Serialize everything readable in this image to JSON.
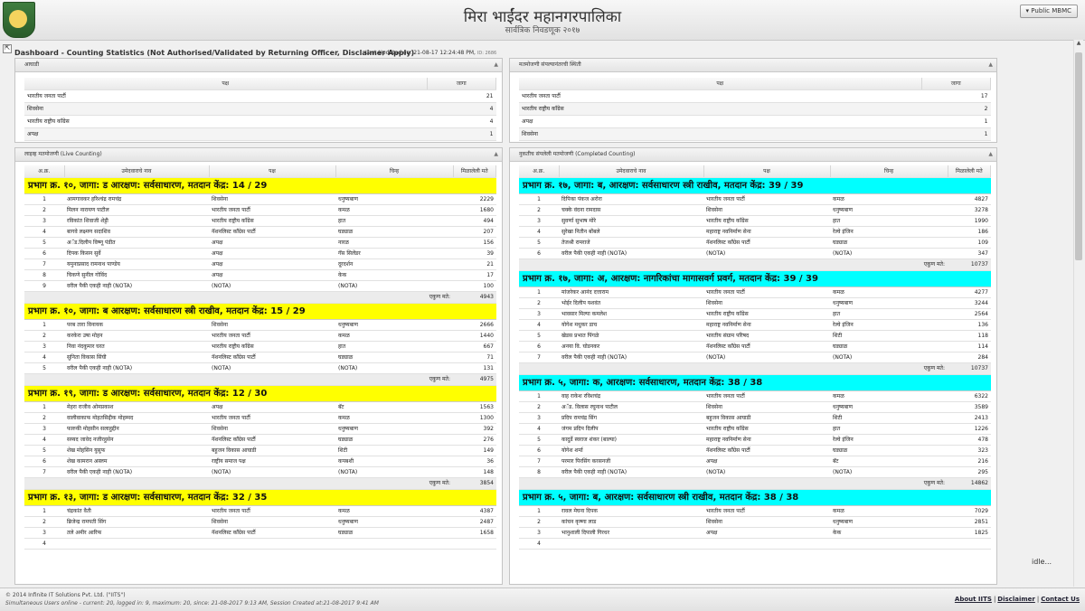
{
  "header": {
    "title": "मिरा भाईंदर महानगरपालिका",
    "subtitle": "सार्वत्रिक निवडणूक २०१७",
    "public_button": "Public MBMC",
    "dropdown_icon": "dropdown-icon"
  },
  "dashboard": {
    "expand_symbol": "⇱",
    "title": "Dashboard - Counting Statistics (Not Authorised/Validated by Returning Officer, Disclaimer Apply)",
    "last_updated": "Last Updated on: 21-08-17 12:24:48 PM,",
    "id": "ID: 2686"
  },
  "leads": {
    "title": "आघाडी",
    "col_party": "पक्ष",
    "col_seats": "जागा",
    "rows": [
      {
        "party": "भारतीय जनता पार्टी",
        "seats": "21"
      },
      {
        "party": "शिवसेना",
        "seats": "4"
      },
      {
        "party": "भारतीय राष्ट्रीय काँग्रेस",
        "seats": "4"
      },
      {
        "party": "अपक्ष",
        "seats": "1"
      }
    ]
  },
  "results": {
    "title": "मतमोजणी संपल्यानंतरची स्थिती",
    "col_party": "पक्ष",
    "col_seats": "जागा",
    "rows": [
      {
        "party": "भारतीय जनता पार्टी",
        "seats": "17"
      },
      {
        "party": "भारतीय राष्ट्रीय काँग्रेस",
        "seats": "2"
      },
      {
        "party": "अपक्ष",
        "seats": "1"
      },
      {
        "party": "शिवसेना",
        "seats": "1"
      }
    ]
  },
  "live": {
    "title": "लाइव्ह मतमोजणी (Live Counting)",
    "headers": {
      "sr": "अ.क्र.",
      "candidate": "उमेदवाराचे नाव",
      "party": "पक्ष",
      "symbol": "चिन्ह",
      "votes": "मिळालेली मते"
    },
    "total_label": "एकुण मते:",
    "wards": [
      {
        "title": "प्रभाग क्र. १०, जागा: ड आरक्षण: सर्वसाधारण, मतदान केंद्र: 14 / 29",
        "total": "4943",
        "rows": [
          {
            "sr": "1",
            "name": "आमगावकर हरिश्चंद्र रामचंद्र",
            "party": "शिवसेना",
            "symbol": "धनुष्यबाण",
            "votes": "2229"
          },
          {
            "sr": "2",
            "name": "मिलन नारायण पाटील",
            "party": "भारतीय जनता पार्टी",
            "symbol": "कमळ",
            "votes": "1680"
          },
          {
            "sr": "3",
            "name": "रविकांत शिवाजी शेट्टी",
            "party": "भारतीय राष्ट्रीय काँग्रेस",
            "symbol": "हात",
            "votes": "494"
          },
          {
            "sr": "4",
            "name": "बागवे लक्ष्मण सदाशिव",
            "party": "नॅशनलिस्ट काँग्रेस पार्टी",
            "symbol": "घड्याळ",
            "votes": "207"
          },
          {
            "sr": "5",
            "name": "अॅड.दिलीप विष्णू पंडीत",
            "party": "अपक्ष",
            "symbol": "नारळ",
            "votes": "156"
          },
          {
            "sr": "6",
            "name": "दिपक किसन सुर्वे",
            "party": "अपक्ष",
            "symbol": "गॅस सिलेंडर",
            "votes": "39"
          },
          {
            "sr": "7",
            "name": "यमुनाप्रसाद रामनाथ पाण्डेय",
            "party": "अपक्ष",
            "symbol": "दूरदर्शन",
            "votes": "21"
          },
          {
            "sr": "8",
            "name": "चिकणे सुनील गोविंद",
            "party": "अपक्ष",
            "symbol": "केक",
            "votes": "17"
          },
          {
            "sr": "9",
            "name": "वरील पैकी एकही नाही (NOTA)",
            "party": "(NOTA)",
            "symbol": "(NOTA)",
            "votes": "100"
          }
        ]
      },
      {
        "title": "प्रभाग क्र. १०, जागा: ब आरक्षण: सर्वसाधारण स्त्री राखीव, मतदान केंद्र: 15 / 29",
        "total": "4975",
        "rows": [
          {
            "sr": "1",
            "name": "परब तारा विनायक",
            "party": "शिवसेना",
            "symbol": "धनुष्यबाण",
            "votes": "2666"
          },
          {
            "sr": "2",
            "name": "करकेरा उषा मोहन",
            "party": "भारतीय जनता पार्टी",
            "symbol": "कमळ",
            "votes": "1440"
          },
          {
            "sr": "3",
            "name": "निवा नंदकुमार घरत",
            "party": "भारतीय राष्ट्रीय काँग्रेस",
            "symbol": "हात",
            "votes": "667"
          },
          {
            "sr": "4",
            "name": "सुनिता विकास सिंघी",
            "party": "नॅशनलिस्ट काँग्रेस पार्टी",
            "symbol": "घड्याळ",
            "votes": "71"
          },
          {
            "sr": "5",
            "name": "वरील पैकी एकही नाही (NOTA)",
            "party": "(NOTA)",
            "symbol": "(NOTA)",
            "votes": "131"
          }
        ]
      },
      {
        "title": "प्रभाग क्र. १९, जागा: ड आरक्षण: सर्वसाधारण, मतदान केंद्र: 12 / 30",
        "total": "3854",
        "rows": [
          {
            "sr": "1",
            "name": "मेहरा राजीव ओमप्रकाश",
            "party": "अपक्ष",
            "symbol": "बॅट",
            "votes": "1563"
          },
          {
            "sr": "2",
            "name": "वालीवाकाफ मोहतसिद्दीक मोहम्मद",
            "party": "भारतीय जनता पार्टी",
            "symbol": "कमळ",
            "votes": "1300"
          },
          {
            "sr": "3",
            "name": "फारुकी मोहसीन सलाहुद्दीन",
            "party": "शिवसेना",
            "symbol": "धनुष्यबाण",
            "votes": "392"
          },
          {
            "sr": "4",
            "name": "सय्यद जावेद नजीरहुसेन",
            "party": "नॅशनलिस्ट काँग्रेस पार्टी",
            "symbol": "घड्याळ",
            "votes": "276"
          },
          {
            "sr": "5",
            "name": "शेख मोहसिन युसुफ",
            "party": "बहुजन विकास आघाडी",
            "symbol": "शिटी",
            "votes": "149"
          },
          {
            "sr": "6",
            "name": "शेख कामरान अस्लम",
            "party": "राष्ट्रीय समाज पक्ष",
            "symbol": "कपबशी",
            "votes": "36"
          },
          {
            "sr": "7",
            "name": "वरील पैकी एकही नाही (NOTA)",
            "party": "(NOTA)",
            "symbol": "(NOTA)",
            "votes": "148"
          }
        ]
      },
      {
        "title": "प्रभाग क्र. १३, जागा: ड आरक्षण: सर्वसाधारण, मतदान केंद्र: 32 / 35",
        "total": "",
        "rows": [
          {
            "sr": "1",
            "name": "चंद्रकांत वैती",
            "party": "भारतीय जनता पार्टी",
            "symbol": "कमळ",
            "votes": "4387"
          },
          {
            "sr": "2",
            "name": "ब्रिजेन्द्र रामपती सिंग",
            "party": "शिवसेना",
            "symbol": "धनुष्यबाण",
            "votes": "2487"
          },
          {
            "sr": "3",
            "name": "तले अमीर आरिफ",
            "party": "नॅशनलिस्ट काँग्रेस पार्टी",
            "symbol": "घड्याळ",
            "votes": "1658"
          },
          {
            "sr": "4",
            "name": "",
            "party": "",
            "symbol": "",
            "votes": ""
          }
        ]
      }
    ]
  },
  "completed": {
    "title": "नुकतीच संपलेली मतमोजणी (Completed Counting)",
    "headers": {
      "sr": "अ.क्र.",
      "candidate": "उमेदवाराचे नाव",
      "party": "पक्ष",
      "symbol": "चिन्ह",
      "votes": "मिळालेली मते"
    },
    "total_label": "एकुण मते:",
    "wards": [
      {
        "title": "प्रभाग क्र. १७, जागा: ब, आरक्षण: सर्वसाधारण स्त्री राखीव, मतदान केंद्र: 39 / 39",
        "total": "10737",
        "rows": [
          {
            "sr": "1",
            "name": "दिपिका पंकज अरोरा",
            "party": "भारतीय जनता पार्टी",
            "symbol": "कमळ",
            "votes": "4827"
          },
          {
            "sr": "2",
            "name": "चक्के वंदना रामदास",
            "party": "शिवसेना",
            "symbol": "धनुष्यबाण",
            "votes": "3278"
          },
          {
            "sr": "3",
            "name": "सुवर्णा सुभाष मोरे",
            "party": "भारतीय राष्ट्रीय काँग्रेस",
            "symbol": "हात",
            "votes": "1990"
          },
          {
            "sr": "4",
            "name": "सुरेखा नितीन बोंबले",
            "party": "महाराष्ट्र नवनिर्माण सेना",
            "symbol": "रेल्वे इंजिन",
            "votes": "186"
          },
          {
            "sr": "5",
            "name": "तेजश्री रामराजे",
            "party": "नॅशनलिस्ट काँग्रेस पार्टी",
            "symbol": "घड्याळ",
            "votes": "109"
          },
          {
            "sr": "6",
            "name": "वरील पैकी एकही नाही (NOTA)",
            "party": "(NOTA)",
            "symbol": "(NOTA)",
            "votes": "347"
          }
        ]
      },
      {
        "title": "प्रभाग क्र. १७, जागा: अ, आरक्षण: नागरिकांचा मागासवर्ग प्रवर्ग, मतदान केंद्र: 39 / 39",
        "total": "10737",
        "rows": [
          {
            "sr": "1",
            "name": "मांजरेकर आनंद दत्ताराम",
            "party": "भारतीय जनता पार्टी",
            "symbol": "कमळ",
            "votes": "4277"
          },
          {
            "sr": "2",
            "name": "भोईर दिलीप यशवंत",
            "party": "शिवसेना",
            "symbol": "धनुष्यबाण",
            "votes": "3244"
          },
          {
            "sr": "3",
            "name": "भावसार मिल्पा कमलेश",
            "party": "भारतीय राष्ट्रीय काँग्रेस",
            "symbol": "हात",
            "votes": "2564"
          },
          {
            "sr": "4",
            "name": "योगेश मधुकर डाच",
            "party": "महाराष्ट्र नवनिर्माण सेना",
            "symbol": "रेल्वे इंजिन",
            "votes": "136"
          },
          {
            "sr": "5",
            "name": "खेडस प्रभात पिंगळे",
            "party": "भारतीय संग्राम परिषद",
            "symbol": "शिटी",
            "votes": "118"
          },
          {
            "sr": "6",
            "name": "अनया वि. घोडनकर",
            "party": "नॅशनलिस्ट काँग्रेस पार्टी",
            "symbol": "घड्याळ",
            "votes": "114"
          },
          {
            "sr": "7",
            "name": "वरील पैकी एकही नाही (NOTA)",
            "party": "(NOTA)",
            "symbol": "(NOTA)",
            "votes": "284"
          }
        ]
      },
      {
        "title": "प्रभाग क्र. ५, जागा: क, आरक्षण: सर्वसाधारण, मतदान केंद्र: 38 / 38",
        "total": "14862",
        "rows": [
          {
            "sr": "1",
            "name": "वाह राकेश रविशचंद्र",
            "party": "भारतीय जनता पार्टी",
            "symbol": "कमळ",
            "votes": "6322"
          },
          {
            "sr": "2",
            "name": "अॅड. विलास रघुनाथ पाटील",
            "party": "शिवसेना",
            "symbol": "धनुष्यबाण",
            "votes": "3589"
          },
          {
            "sr": "3",
            "name": "प्रदिप रामचंद्र सिंग",
            "party": "बहुजन विकास आघाडी",
            "symbol": "शिटी",
            "votes": "2413"
          },
          {
            "sr": "4",
            "name": "जंगम प्रदिप दिलीप",
            "party": "भारतीय राष्ट्रीय काँग्रेस",
            "symbol": "हात",
            "votes": "1226"
          },
          {
            "sr": "5",
            "name": "कादुर्डे स्वराज शंकर (बाल्या)",
            "party": "महाराष्ट्र नवनिर्माण सेना",
            "symbol": "रेल्वे इंजिन",
            "votes": "478"
          },
          {
            "sr": "6",
            "name": "योगेश शर्मा",
            "party": "नॅशनलिस्ट काँग्रेस पार्टी",
            "symbol": "घड्याळ",
            "votes": "323"
          },
          {
            "sr": "7",
            "name": "परमार पिरसिंग करसनजी",
            "party": "अपक्ष",
            "symbol": "बॅट",
            "votes": "216"
          },
          {
            "sr": "8",
            "name": "वरील पैकी एकही नाही (NOTA)",
            "party": "(NOTA)",
            "symbol": "(NOTA)",
            "votes": "295"
          }
        ]
      },
      {
        "title": "प्रभाग क्र. ५, जागा: ब, आरक्षण: सर्वसाधारण स्त्री राखीव, मतदान केंद्र: 38 / 38",
        "total": "",
        "rows": [
          {
            "sr": "1",
            "name": "रावल मेघना दिपक",
            "party": "भारतीय जनता पार्टी",
            "symbol": "कमळ",
            "votes": "7029"
          },
          {
            "sr": "2",
            "name": "कांचन कृष्णा लाड",
            "party": "शिवसेना",
            "symbol": "धनुष्यबाण",
            "votes": "2851"
          },
          {
            "sr": "3",
            "name": "भानुशाली दिपाली गिरधर",
            "party": "अपक्ष",
            "symbol": "केक",
            "votes": "1825"
          },
          {
            "sr": "4",
            "name": "",
            "party": "",
            "symbol": "",
            "votes": ""
          }
        ]
      }
    ]
  },
  "idle_text": "idle...",
  "footer": {
    "copyright": "© 2014   Infinite IT Solutions Pvt. Ltd. (\"IITS\")",
    "users_online": "Simultaneous Users online - current: 20, logged in: 9, maximum: 20, since: 21-08-2017 9:13 AM, Session Created at:21-08-2017 9:41 AM",
    "links": [
      "About IITS",
      "Disclaimer",
      "Contact Us"
    ]
  },
  "colors": {
    "live_ward_bg": "#ffff00",
    "completed_ward_bg": "#00ffff"
  }
}
